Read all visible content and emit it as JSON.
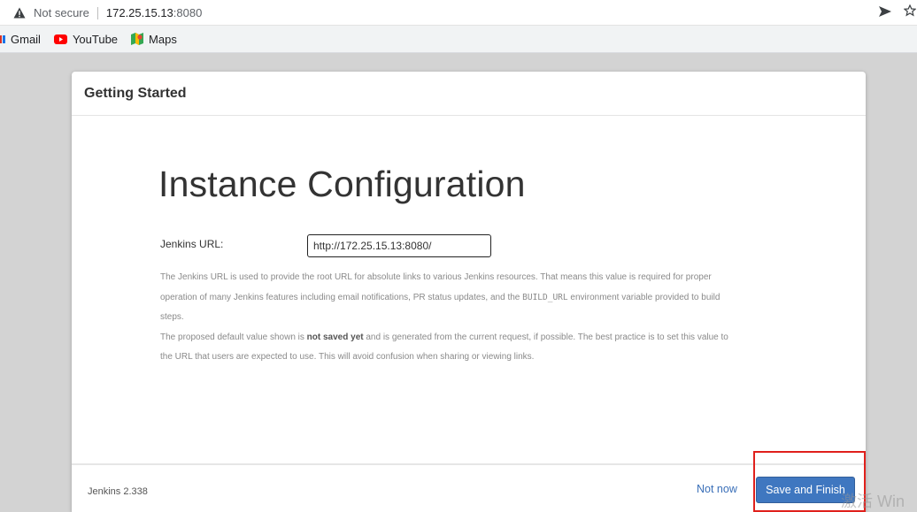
{
  "browser": {
    "warning_icon": "warning-icon",
    "not_secure": "Not secure",
    "host": "172.25.15.13",
    "port": ":8080",
    "bookmarks": [
      {
        "label": "Gmail",
        "icon": "gmail-icon"
      },
      {
        "label": "YouTube",
        "icon": "youtube-icon"
      },
      {
        "label": "Maps",
        "icon": "maps-icon"
      }
    ]
  },
  "dialog": {
    "header": "Getting Started",
    "title": "Instance Configuration",
    "url_label": "Jenkins URL:",
    "url_value": "http://172.25.15.13:8080/",
    "help_line1": "The Jenkins URL is used to provide the root URL for absolute links to various Jenkins resources. That means this value is required for proper",
    "help_line2_a": "operation of many Jenkins features including email notifications, PR status updates, and the ",
    "help_line2_code": "BUILD_URL",
    "help_line2_b": " environment variable provided to build",
    "help_line3": "steps.",
    "help_line4_a": "The proposed default value shown is ",
    "help_line4_bold": "not saved yet",
    "help_line4_b": " and is generated from the current request, if possible. The best practice is to set this value to",
    "help_line5": "the URL that users are expected to use. This will avoid confusion when sharing or viewing links.",
    "version": "Jenkins 2.338",
    "not_now": "Not now",
    "save": "Save and Finish"
  },
  "watermark": "激活 Win",
  "colors": {
    "primary_button": "#3f77c0",
    "link": "#3a6fb8",
    "highlight_box": "#e0201c"
  }
}
